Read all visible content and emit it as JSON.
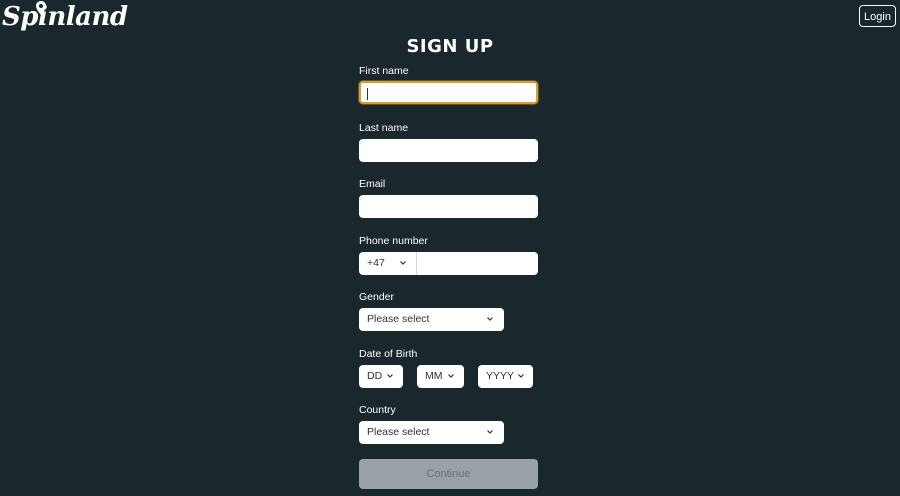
{
  "header": {
    "logo_text": "Spinland",
    "login_label": "Login"
  },
  "form": {
    "title": "SIGN UP",
    "first_name": {
      "label": "First name",
      "value": ""
    },
    "last_name": {
      "label": "Last name",
      "value": ""
    },
    "email": {
      "label": "Email",
      "value": ""
    },
    "phone": {
      "label": "Phone number",
      "country_code": "+47",
      "value": ""
    },
    "gender": {
      "label": "Gender",
      "selected": "Please select"
    },
    "dob": {
      "label": "Date of Birth",
      "day": "DD",
      "month": "MM",
      "year": "YYYY"
    },
    "country": {
      "label": "Country",
      "selected": "Please select"
    },
    "continue_label": "Continue"
  },
  "colors": {
    "background": "#1a272d",
    "focus_border": "#c9a14a",
    "button_disabled": "#99a2a7"
  },
  "icons": {
    "logo_pin": "map-pin-icon",
    "dropdown": "chevron-down-icon"
  }
}
